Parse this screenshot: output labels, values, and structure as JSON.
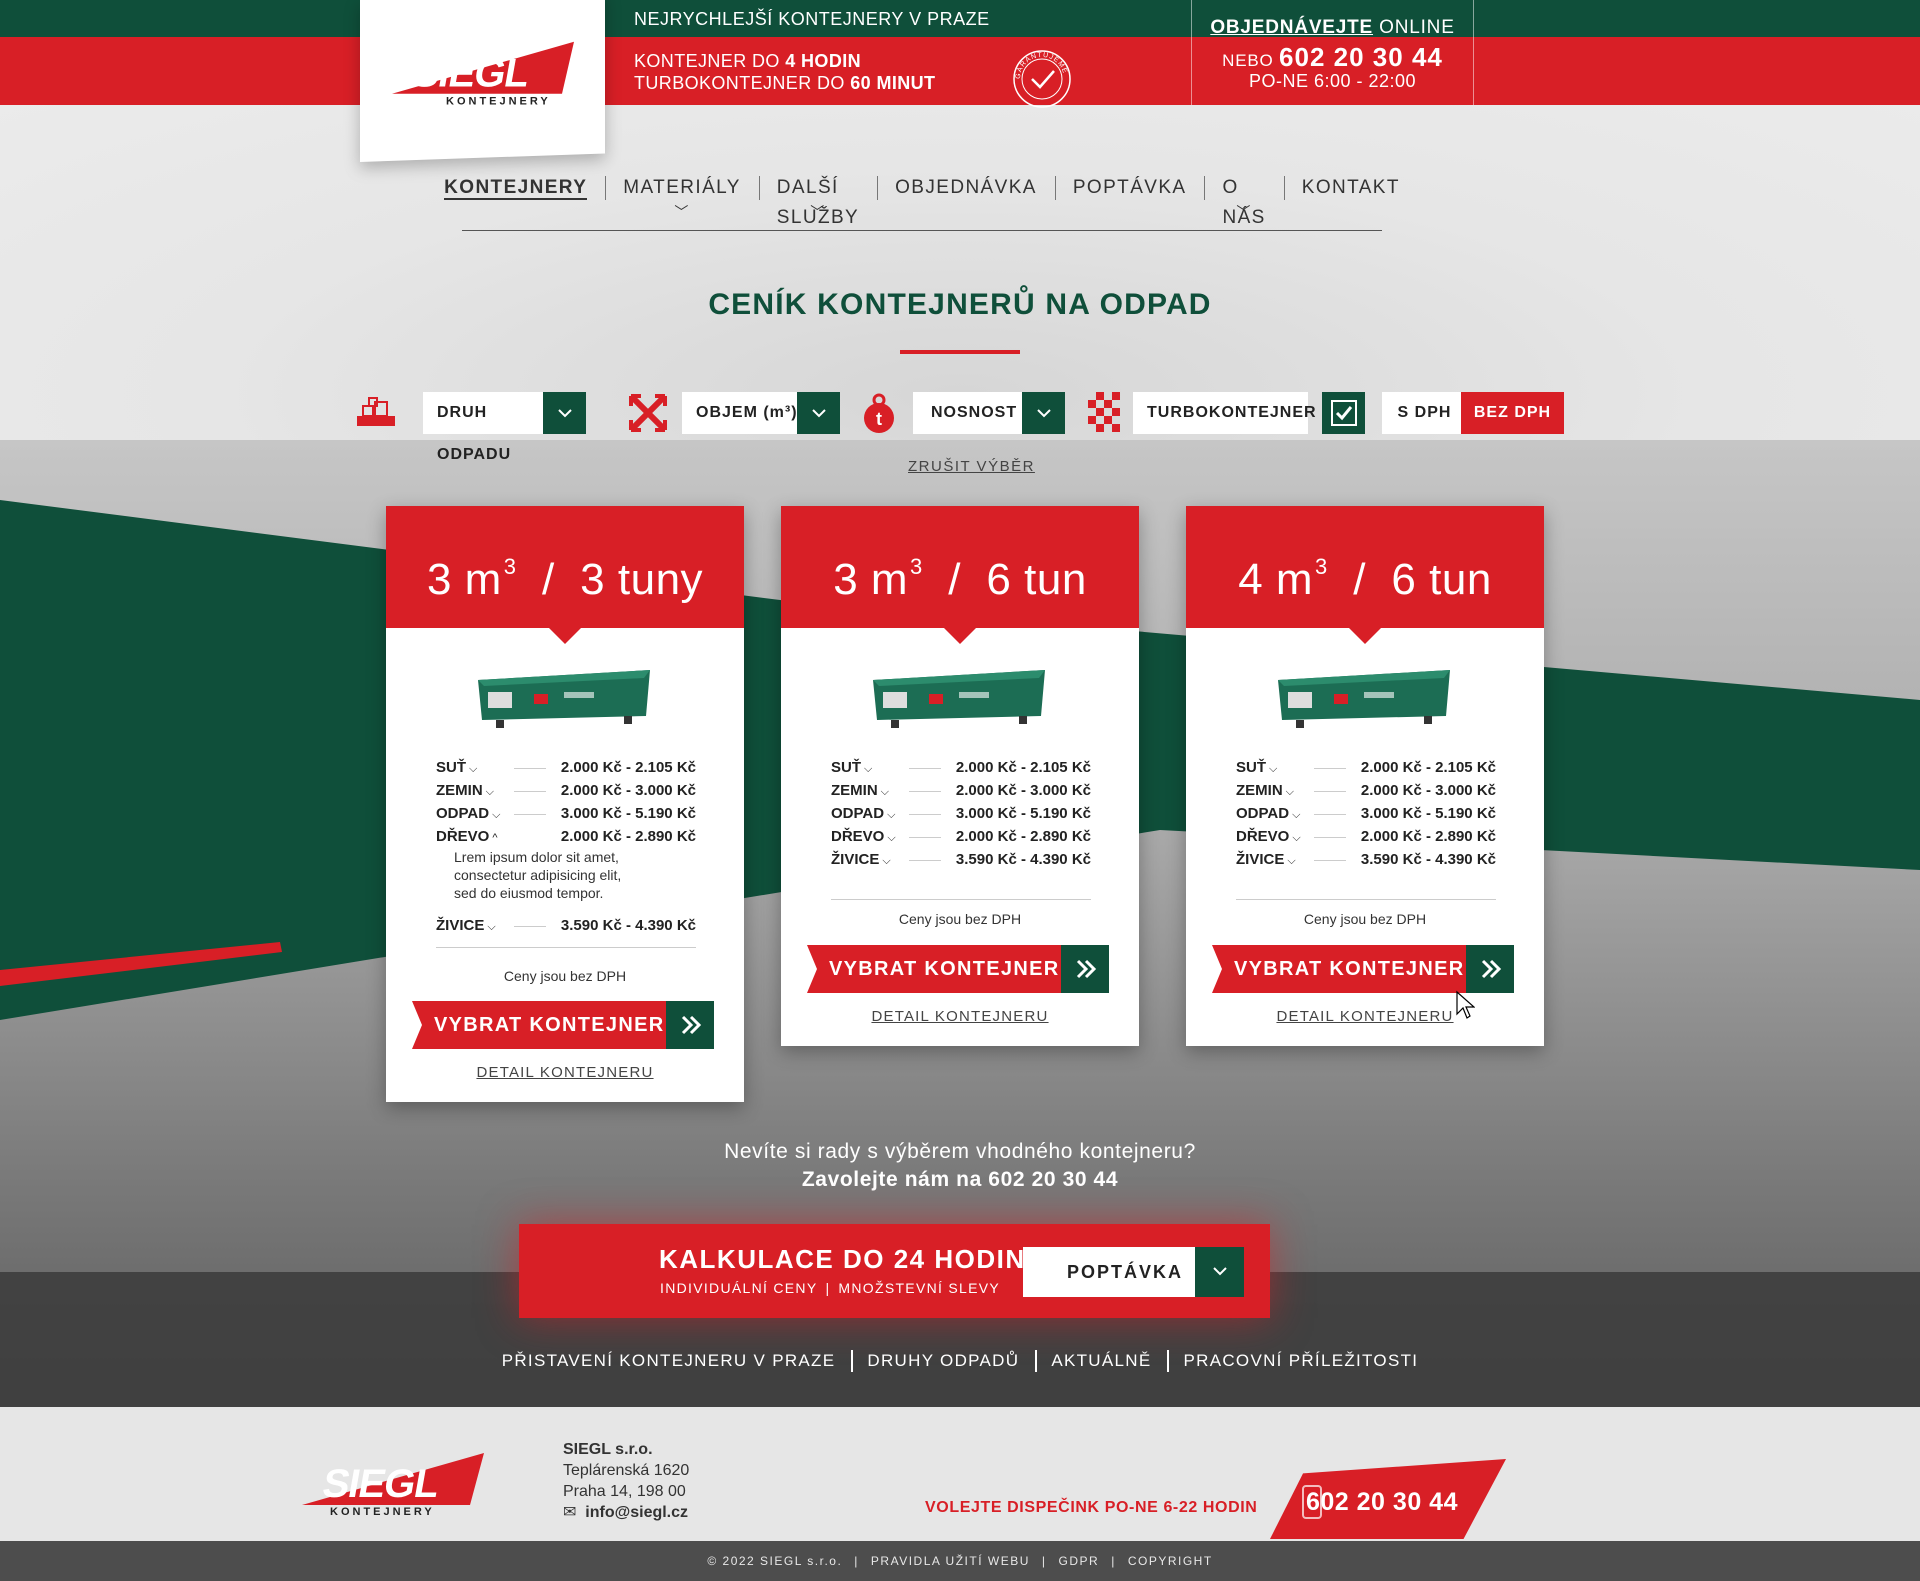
{
  "header": {
    "tagline": "NEJRYCHLEJŠÍ KONTEJNERY V PRAZE",
    "promise_line1_prefix": "KONTEJNER DO",
    "promise_line1_bold": "4 HODIN",
    "promise_line2_prefix": "TURBOKONTEJNER DO",
    "promise_line2_bold": "60 MINUT",
    "stamp_text": "GARANTUJEME CENU",
    "order_link": "OBJEDNÁVEJTE",
    "order_online": "ONLINE",
    "order_or": "NEBO",
    "order_phone": "602 20 30 44",
    "order_hours": "PO-NE 6:00 - 22:00"
  },
  "logo": {
    "name": "SIEGL",
    "sub": "KONTEJNERY",
    "reg": "®"
  },
  "nav": {
    "items": [
      {
        "label": "KONTEJNERY",
        "active": true,
        "dropdown": false
      },
      {
        "label": "MATERIÁLY",
        "active": false,
        "dropdown": true
      },
      {
        "label": "DALŠÍ SLUŽBY",
        "active": false,
        "dropdown": true
      },
      {
        "label": "OBJEDNÁVKA",
        "active": false,
        "dropdown": false
      },
      {
        "label": "POPTÁVKA",
        "active": false,
        "dropdown": false
      },
      {
        "label": "O NÁS",
        "active": false,
        "dropdown": true
      },
      {
        "label": "KONTAKT",
        "active": false,
        "dropdown": false
      }
    ]
  },
  "page_title": "CENÍK KONTEJNERŮ NA ODPAD",
  "filters": {
    "waste_type": "DRUH ODPADU",
    "volume": "OBJEM (m³)",
    "capacity": "NOSNOST",
    "turbo": "TURBOKONTEJNER",
    "turbo_checked": true,
    "with_vat": "S DPH",
    "without_vat": "BEZ DPH",
    "vat_selected": "BEZ DPH",
    "reset": "ZRUŠIT VÝBĚR"
  },
  "cards": [
    {
      "volume": "3 m",
      "sup": "3",
      "weight": "3 tuny",
      "prices": [
        {
          "name": "SUŤ",
          "price": "2.000 Kč - 2.105 Kč",
          "expanded": false
        },
        {
          "name": "ZEMIN",
          "price": "2.000 Kč - 3.000 Kč",
          "expanded": false
        },
        {
          "name": "ODPAD",
          "price": "3.000 Kč - 5.190 Kč",
          "expanded": false
        },
        {
          "name": "DŘEVO",
          "price": "2.000 Kč - 2.890 Kč",
          "expanded": true,
          "description": "Lrem ipsum dolor sit amet, consectetur adipisicing elit, sed do eiusmod tempor."
        },
        {
          "name": "ŽIVICE",
          "price": "3.590 Kč - 4.390 Kč",
          "expanded": false
        }
      ],
      "note": "Ceny jsou bez DPH",
      "select": "VYBRAT KONTEJNER",
      "detail": "DETAIL KONTEJNERU"
    },
    {
      "volume": "3 m",
      "sup": "3",
      "weight": "6 tun",
      "prices": [
        {
          "name": "SUŤ",
          "price": "2.000 Kč - 2.105 Kč"
        },
        {
          "name": "ZEMIN",
          "price": "2.000 Kč - 3.000 Kč"
        },
        {
          "name": "ODPAD",
          "price": "3.000 Kč - 5.190 Kč"
        },
        {
          "name": "DŘEVO",
          "price": "2.000 Kč - 2.890 Kč"
        },
        {
          "name": "ŽIVICE",
          "price": "3.590 Kč - 4.390 Kč"
        }
      ],
      "note": "Ceny jsou bez DPH",
      "select": "VYBRAT KONTEJNER",
      "detail": "DETAIL KONTEJNERU"
    },
    {
      "volume": "4 m",
      "sup": "3",
      "weight": "6 tun",
      "prices": [
        {
          "name": "SUŤ",
          "price": "2.000 Kč - 2.105 Kč"
        },
        {
          "name": "ZEMIN",
          "price": "2.000 Kč - 3.000 Kč"
        },
        {
          "name": "ODPAD",
          "price": "3.000 Kč - 5.190 Kč"
        },
        {
          "name": "DŘEVO",
          "price": "2.000 Kč - 2.890 Kč"
        },
        {
          "name": "ŽIVICE",
          "price": "3.590 Kč - 4.390 Kč"
        }
      ],
      "note": "Ceny jsou bez DPH",
      "select": "VYBRAT KONTEJNER",
      "detail": "DETAIL KONTEJNERU"
    }
  ],
  "help": {
    "line1": "Nevíte si rady s výběrem vhodného kontejneru?",
    "line2": "Zavolejte nám na 602 20 30 44"
  },
  "calc": {
    "title": "KALKULACE DO 24 HODIN",
    "sub1": "INDIVIDUÁLNÍ CENY",
    "sub2": "MNOŽSTEVNÍ SLEVY",
    "button": "POPTÁVKA"
  },
  "links": [
    "PŘISTAVENÍ KONTEJNERU V PRAZE",
    "DRUHY ODPADŮ",
    "AKTUÁLNĚ",
    "PRACOVNÍ PŘÍLEŽITOSTI"
  ],
  "footer": {
    "company": "SIEGL s.r.o.",
    "street": "Teplárenská 1620",
    "city": "Praha 14, 198 00",
    "email": "info@siegl.cz",
    "dispatch": "VOLEJTE DISPEČINK PO-NE 6-22 HODIN",
    "phone": "602 20 30 44",
    "copyright": "© 2022 SIEGL s.r.o.",
    "rules": "PRAVIDLA UŽITÍ WEBU",
    "gdpr": "GDPR",
    "copyright_link": "COPYRIGHT"
  },
  "colors": {
    "red": "#d81f26",
    "green": "#0f4f3a",
    "gray": "#e9e9e9"
  }
}
